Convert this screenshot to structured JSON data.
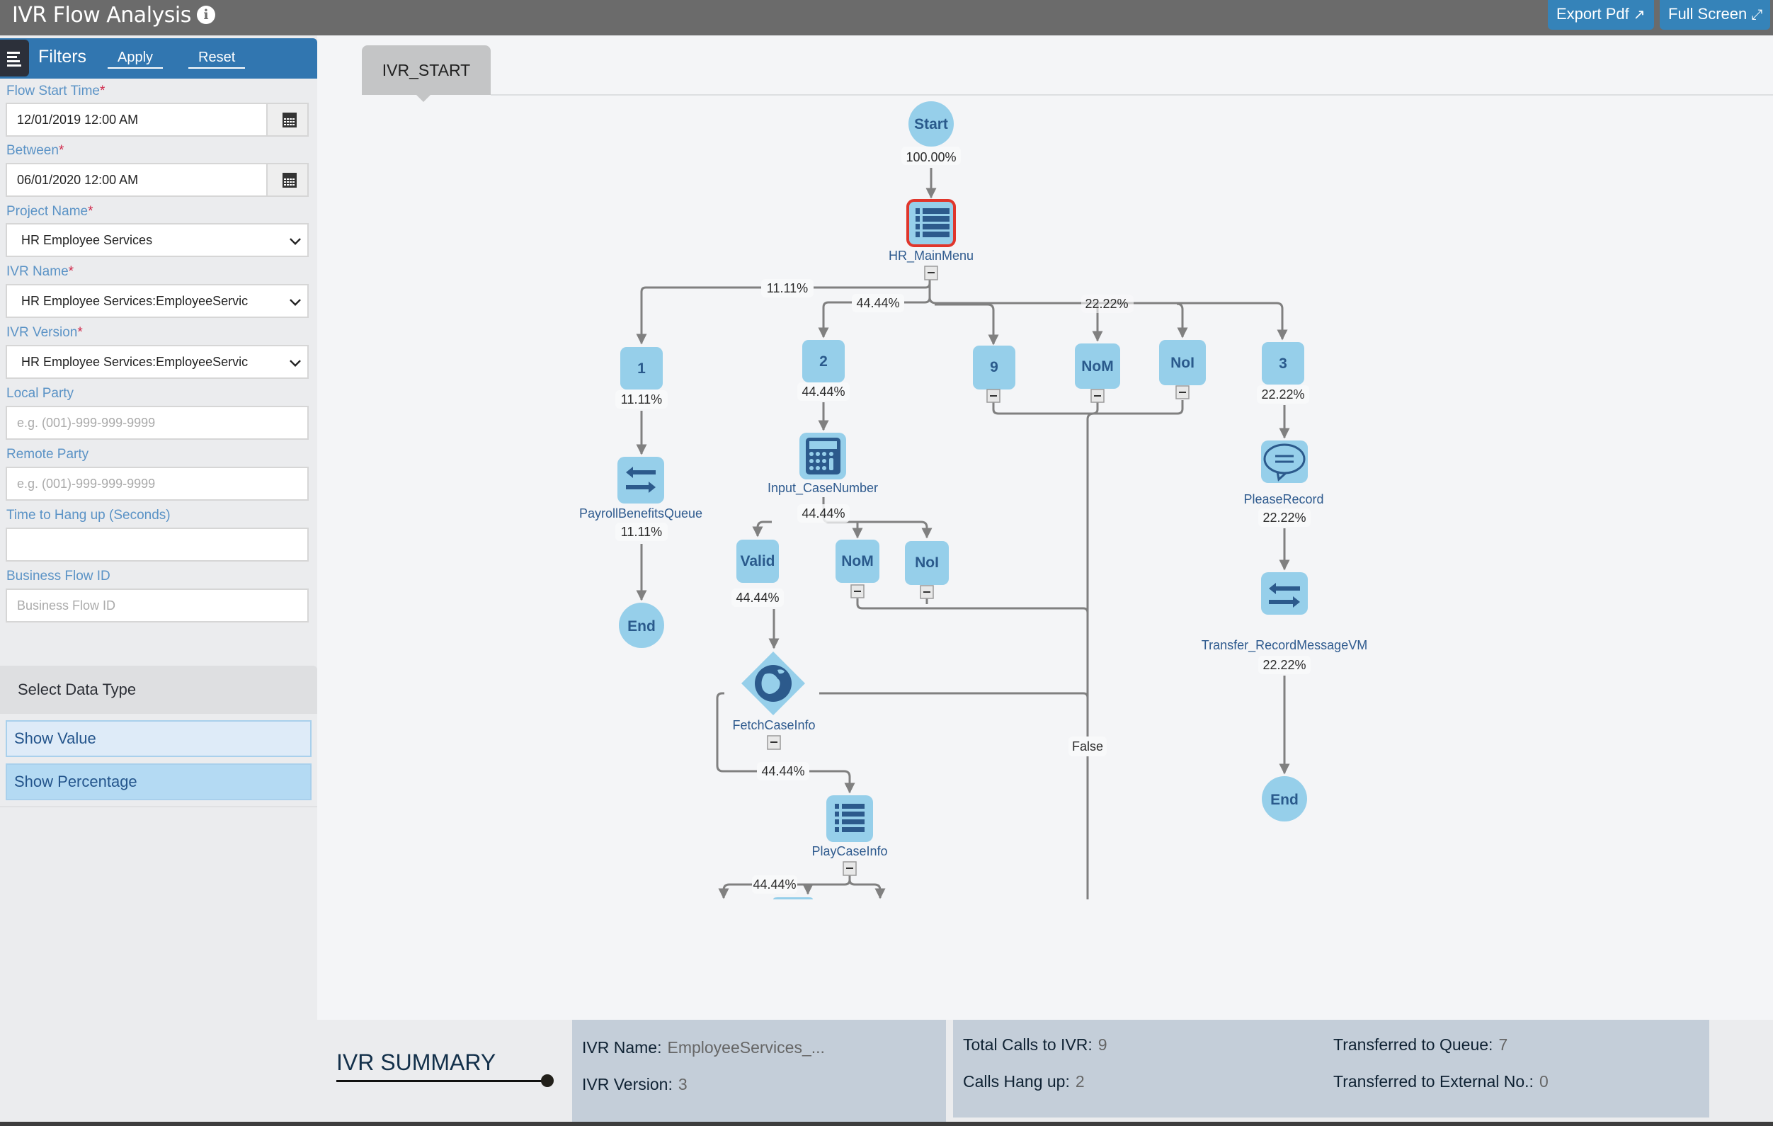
{
  "header": {
    "title": "IVR Flow Analysis",
    "info_icon": "info-circle-icon",
    "export_label": "Export Pdf",
    "export_icon": "external-link-icon",
    "fullscreen_label": "Full Screen",
    "fullscreen_icon": "expand-arrows-icon"
  },
  "filters": {
    "title": "Filters",
    "apply_label": "Apply",
    "reset_label": "Reset",
    "fields": {
      "flow_start_time": {
        "label": "Flow Start Time",
        "required": "*",
        "value": "12/01/2019 12:00 AM"
      },
      "between": {
        "label": "Between",
        "required": "*",
        "value": "06/01/2020 12:00 AM"
      },
      "project_name": {
        "label": "Project Name",
        "required": "*",
        "value": "HR Employee Services"
      },
      "ivr_name": {
        "label": "IVR Name",
        "required": "*",
        "value": "HR Employee Services:EmployeeServic"
      },
      "ivr_version": {
        "label": "IVR Version",
        "required": "*",
        "value": "HR Employee Services:EmployeeServic"
      },
      "local_party": {
        "label": "Local Party",
        "placeholder": "e.g. (001)-999-999-9999",
        "value": ""
      },
      "remote_party": {
        "label": "Remote Party",
        "placeholder": "e.g. (001)-999-999-9999",
        "value": ""
      },
      "time_to_hangup": {
        "label": "Time to Hang up (Seconds)",
        "value": ""
      },
      "business_flow_id": {
        "label": "Business Flow ID",
        "placeholder": "Business Flow ID",
        "value": ""
      }
    },
    "data_type": {
      "title": "Select Data Type",
      "options": [
        "Show Value",
        "Show Percentage"
      ],
      "selected": "Show Percentage"
    }
  },
  "flow": {
    "tab_label": "IVR_START",
    "nodes": {
      "start": {
        "text": "Start",
        "pct": "100.00%"
      },
      "main_menu": {
        "label": "HR_MainMenu",
        "icon": "list-menu-icon",
        "highlighted": true
      },
      "opt1": {
        "text": "1",
        "pct": "11.11%"
      },
      "opt2": {
        "text": "2",
        "pct": "44.44%"
      },
      "opt9": {
        "text": "9"
      },
      "optNoM_top": {
        "text": "NoM"
      },
      "optNoI_top": {
        "text": "NoI"
      },
      "opt3": {
        "text": "3",
        "pct": "22.22%"
      },
      "payroll_queue": {
        "label": "PayrollBenefitsQueue",
        "icon": "transfer-arrows-icon",
        "pct": "11.11%"
      },
      "end_left": {
        "text": "End"
      },
      "input_case": {
        "label": "Input_CaseNumber",
        "icon": "calculator-icon",
        "pct": "44.44%"
      },
      "valid": {
        "text": "Valid",
        "pct": "44.44%"
      },
      "nom_mid": {
        "text": "NoM"
      },
      "noi_mid": {
        "text": "NoI"
      },
      "fetch_case": {
        "label": "FetchCaseInfo",
        "icon": "globe-icon"
      },
      "play_case": {
        "label": "PlayCaseInfo",
        "icon": "list-menu-icon"
      },
      "please_record": {
        "label": "PleaseRecord",
        "icon": "speech-bubble-icon",
        "pct": "22.22%"
      },
      "transfer_vm": {
        "label": "Transfer_RecordMessageVM",
        "icon": "transfer-arrows-icon",
        "pct": "22.22%"
      },
      "end_right": {
        "text": "End"
      }
    },
    "edge_labels": {
      "menu_to_1": "11.11%",
      "menu_to_2": "44.44%",
      "menu_to_3": "22.22%",
      "fetch_to_play": "44.44%",
      "play_branch": "44.44%",
      "false_branch": "False"
    }
  },
  "summary": {
    "title": "IVR SUMMARY",
    "ivr_name_label": "IVR Name:",
    "ivr_name_value": "EmployeeServices_...",
    "ivr_version_label": "IVR Version:",
    "ivr_version_value": "3",
    "total_calls_label": "Total Calls to IVR:",
    "total_calls_value": "9",
    "hangup_label": "Calls Hang up:",
    "hangup_value": "2",
    "queue_label": "Transferred to Queue:",
    "queue_value": "7",
    "external_label": "Transferred to External No.:",
    "external_value": "0"
  },
  "colors": {
    "header_bg": "#6b6b6b",
    "accent_blue": "#3176b0",
    "node_fill": "#96cfea",
    "node_text": "#2a5a8c",
    "highlight_border": "#e0362c",
    "edge": "#808080"
  }
}
